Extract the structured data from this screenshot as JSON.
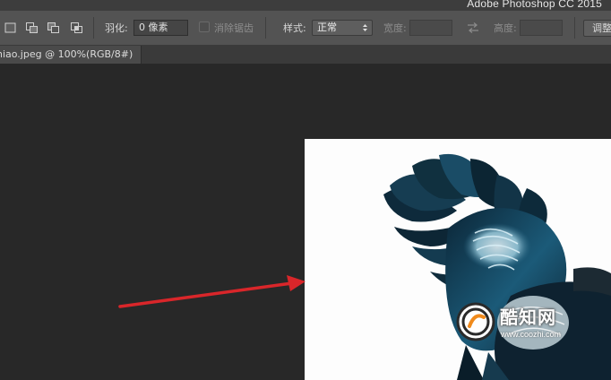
{
  "app": {
    "title": "Adobe Photoshop CC 2015"
  },
  "options": {
    "feather_label": "羽化:",
    "feather_value": "0 像素",
    "antialias_label": "消除锯齿",
    "style_label": "样式:",
    "style_value": "正常",
    "width_label": "宽度:",
    "width_value": "",
    "height_label": "高度:",
    "height_value": "",
    "refine_button": "调整"
  },
  "document": {
    "tab_title": "niao.jpeg @ 100%(RGB/8#)"
  },
  "icons": {
    "selection_modes": [
      "new-selection-icon",
      "add-to-selection-icon",
      "subtract-from-selection-icon",
      "intersect-selection-icon"
    ],
    "swap": "swap-arrows-icon"
  },
  "annotation": {
    "arrow_color": "#d9262a"
  },
  "watermark": {
    "name": "酷知网",
    "url": "www.coozhi.com"
  },
  "colors": {
    "bird_dark": "#0f2a3c",
    "bird_mid": "#1d5f7e",
    "bird_light": "#6fb0c9"
  }
}
